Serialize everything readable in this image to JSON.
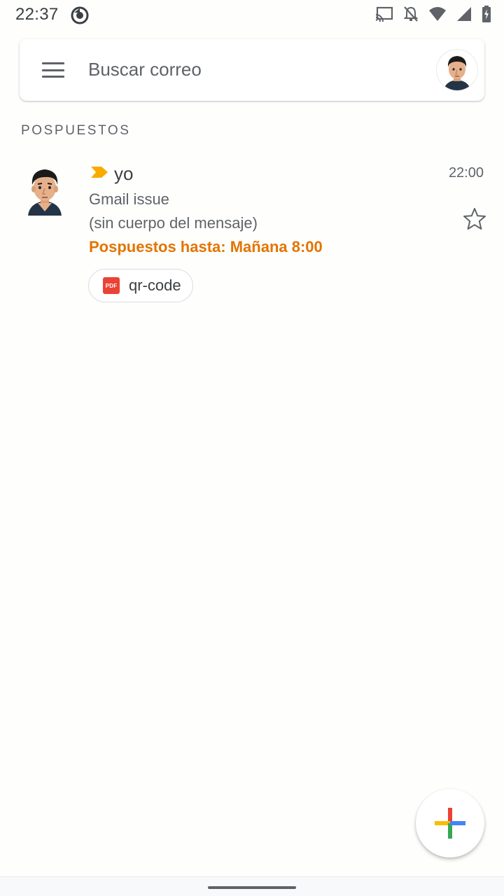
{
  "status_bar": {
    "time": "22:37",
    "icons": [
      "sync-icon",
      "cast-icon",
      "notifications-off-icon",
      "wifi-icon",
      "signal-icon",
      "battery-charging-icon"
    ]
  },
  "search": {
    "placeholder": "Buscar correo",
    "menu_icon": "hamburger-menu-icon",
    "avatar_icon": "account-avatar"
  },
  "section": {
    "title": "POSPUESTOS"
  },
  "emails": [
    {
      "sender": "yo",
      "time": "22:00",
      "subject": "Gmail issue",
      "snippet": "(sin cuerpo del mensaje)",
      "snooze": "Pospuestos hasta: Mañana 8:00",
      "important": true,
      "starred": false,
      "attachment": {
        "type": "PDF",
        "name": "qr-code"
      }
    }
  ],
  "colors": {
    "accent_snooze": "#e37400",
    "importance_marker": "#f9ab00",
    "pdf_red": "#ea4335",
    "compose_red": "#ea4335",
    "compose_yellow": "#fbbc04",
    "compose_green": "#34a853",
    "compose_blue": "#4285f4"
  },
  "compose": {
    "icon": "compose-plus-icon"
  }
}
